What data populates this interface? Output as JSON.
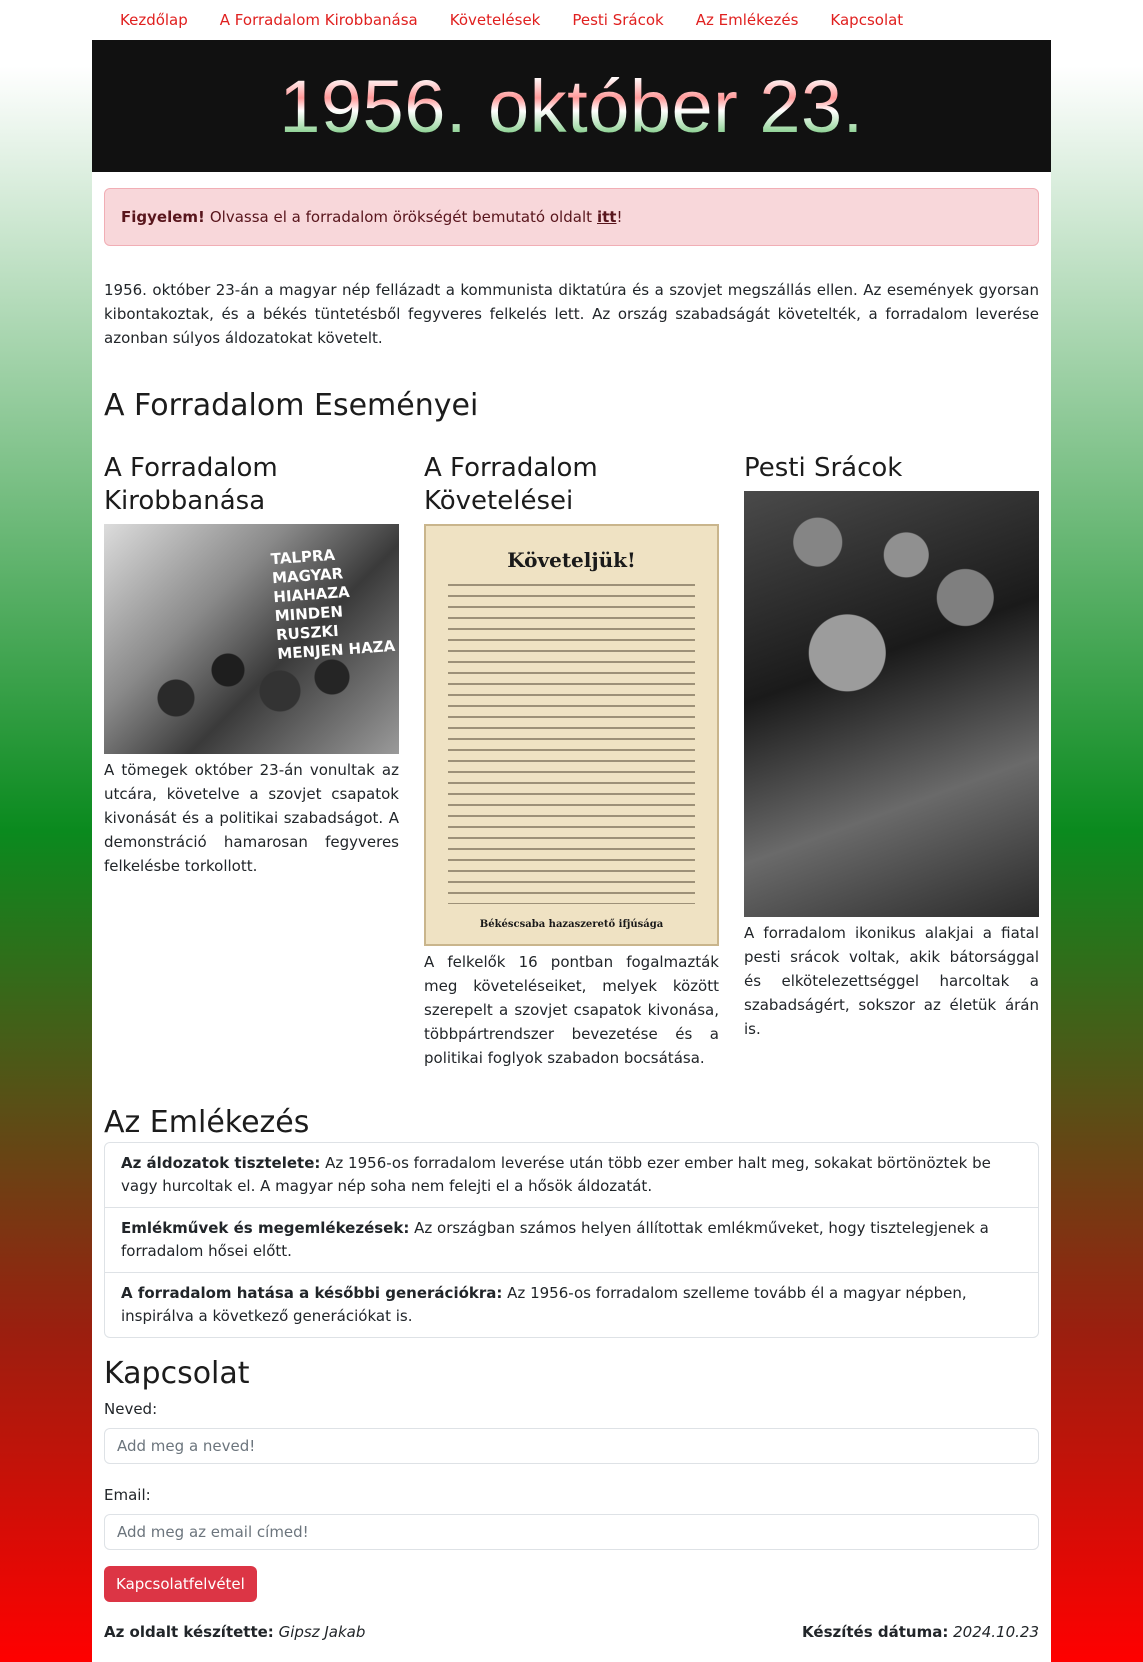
{
  "nav": [
    "Kezdőlap",
    "A Forradalom Kirobbanása",
    "Követelések",
    "Pesti Srácok",
    "Az Emlékezés",
    "Kapcsolat"
  ],
  "banner": {
    "title": "1956. október 23."
  },
  "alert": {
    "strong": "Figyelem!",
    "text": "Olvassa el a forradalom örökségét bemutató oldalt",
    "link": "itt",
    "end": "!"
  },
  "intro": "1956. október 23-án a magyar nép fellázadt a kommunista diktatúra és a szovjet megszállás ellen. Az események gyorsan kibontakoztak, és a békés tüntetésből fegyveres felkelés lett. Az ország szabadságát követelték, a forradalom leverése azonban súlyos áldozatokat követelt.",
  "events": {
    "heading": "A Forradalom Eseményei",
    "columns": [
      {
        "title": "A Forradalom Kirobbanása",
        "graffiti": "TALPRA MAGYAR HIAHAZA MINDEN RUSZKI MENJEN HAZA",
        "text": "A tömegek október 23-án vonultak az utcára, követelve a szovjet csapatok kivonását és a politikai szabadságot. A demonstráció hamarosan fegyveres felkelésbe torkollott."
      },
      {
        "title": "A Forradalom Követelései",
        "poster_title": "Követeljük!",
        "poster_sign": "Békéscsaba hazaszerető ifjúsága",
        "text": "A felkelők 16 pontban fogalmazták meg követeléseiket, melyek között szerepelt a szovjet csapatok kivonása, többpártrendszer bevezetése és a politikai foglyok szabadon bocsátása."
      },
      {
        "title": "Pesti Srácok",
        "text": "A forradalom ikonikus alakjai a fiatal pesti srácok voltak, akik bátorsággal és elkötelezettséggel harcoltak a szabadságért, sokszor az életük árán is."
      }
    ]
  },
  "memory": {
    "heading": "Az Emlékezés",
    "items": [
      {
        "bold": "Az áldozatok tisztelete:",
        "text": "Az 1956-os forradalom leverése után több ezer ember halt meg, sokakat börtönöztek be vagy hurcoltak el. A magyar nép soha nem felejti el a hősök áldozatát."
      },
      {
        "bold": "Emlékművek és megemlékezések:",
        "text": "Az országban számos helyen állítottak emlékműveket, hogy tisztelegjenek a forradalom hősei előtt."
      },
      {
        "bold": "A forradalom hatása a későbbi generációkra:",
        "text": "Az 1956-os forradalom szelleme tovább él a magyar népben, inspirálva a következő generációkat is."
      }
    ]
  },
  "contact": {
    "heading": "Kapcsolat",
    "name_label": "Neved:",
    "name_placeholder": "Add meg a neved!",
    "email_label": "Email:",
    "email_placeholder": "Add meg az email címed!",
    "button": "Kapcsolatfelvétel"
  },
  "footer": {
    "author_label": "Az oldalt készítette:",
    "author": "Gipsz Jakab",
    "date_label": "Készítés dátuma:",
    "date": "2024.10.23"
  },
  "colors": {
    "nav_link": "#e0201f",
    "button": "#dc3545",
    "alert_bg": "#f8d7da"
  }
}
